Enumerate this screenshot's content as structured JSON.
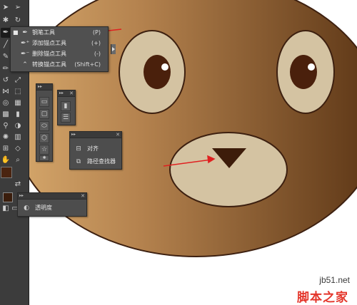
{
  "pen_flyout": {
    "items": [
      {
        "label": "钢笔工具",
        "shortcut": "(P)",
        "icon": "pen-icon",
        "active": true
      },
      {
        "label": "添加锚点工具",
        "shortcut": "(+)",
        "icon": "add-anchor-icon",
        "active": false
      },
      {
        "label": "删除锚点工具",
        "shortcut": "(-)",
        "icon": "delete-anchor-icon",
        "active": false
      },
      {
        "label": "转换锚点工具",
        "shortcut": "(Shift+C)",
        "icon": "convert-anchor-icon",
        "active": false
      }
    ]
  },
  "align_panel": {
    "items": [
      {
        "label": "对齐",
        "icon": "align-icon"
      },
      {
        "label": "路径查找器",
        "icon": "pathfinder-icon"
      }
    ]
  },
  "transparency_panel": {
    "items": [
      {
        "label": "透明度",
        "icon": "transparency-icon"
      }
    ]
  },
  "watermark": {
    "domain": "jb51.net",
    "name": "脚本之家"
  },
  "colors": {
    "bear_face_light": "#c8955e",
    "bear_face_dark": "#5b3414",
    "eye_white": "#d6c5a4",
    "pupil": "#4a200c",
    "outline": "#3d2010",
    "toolbar": "#3c3c3c",
    "panel": "#4d4d4d",
    "annotation_arrow": "#e02020"
  }
}
